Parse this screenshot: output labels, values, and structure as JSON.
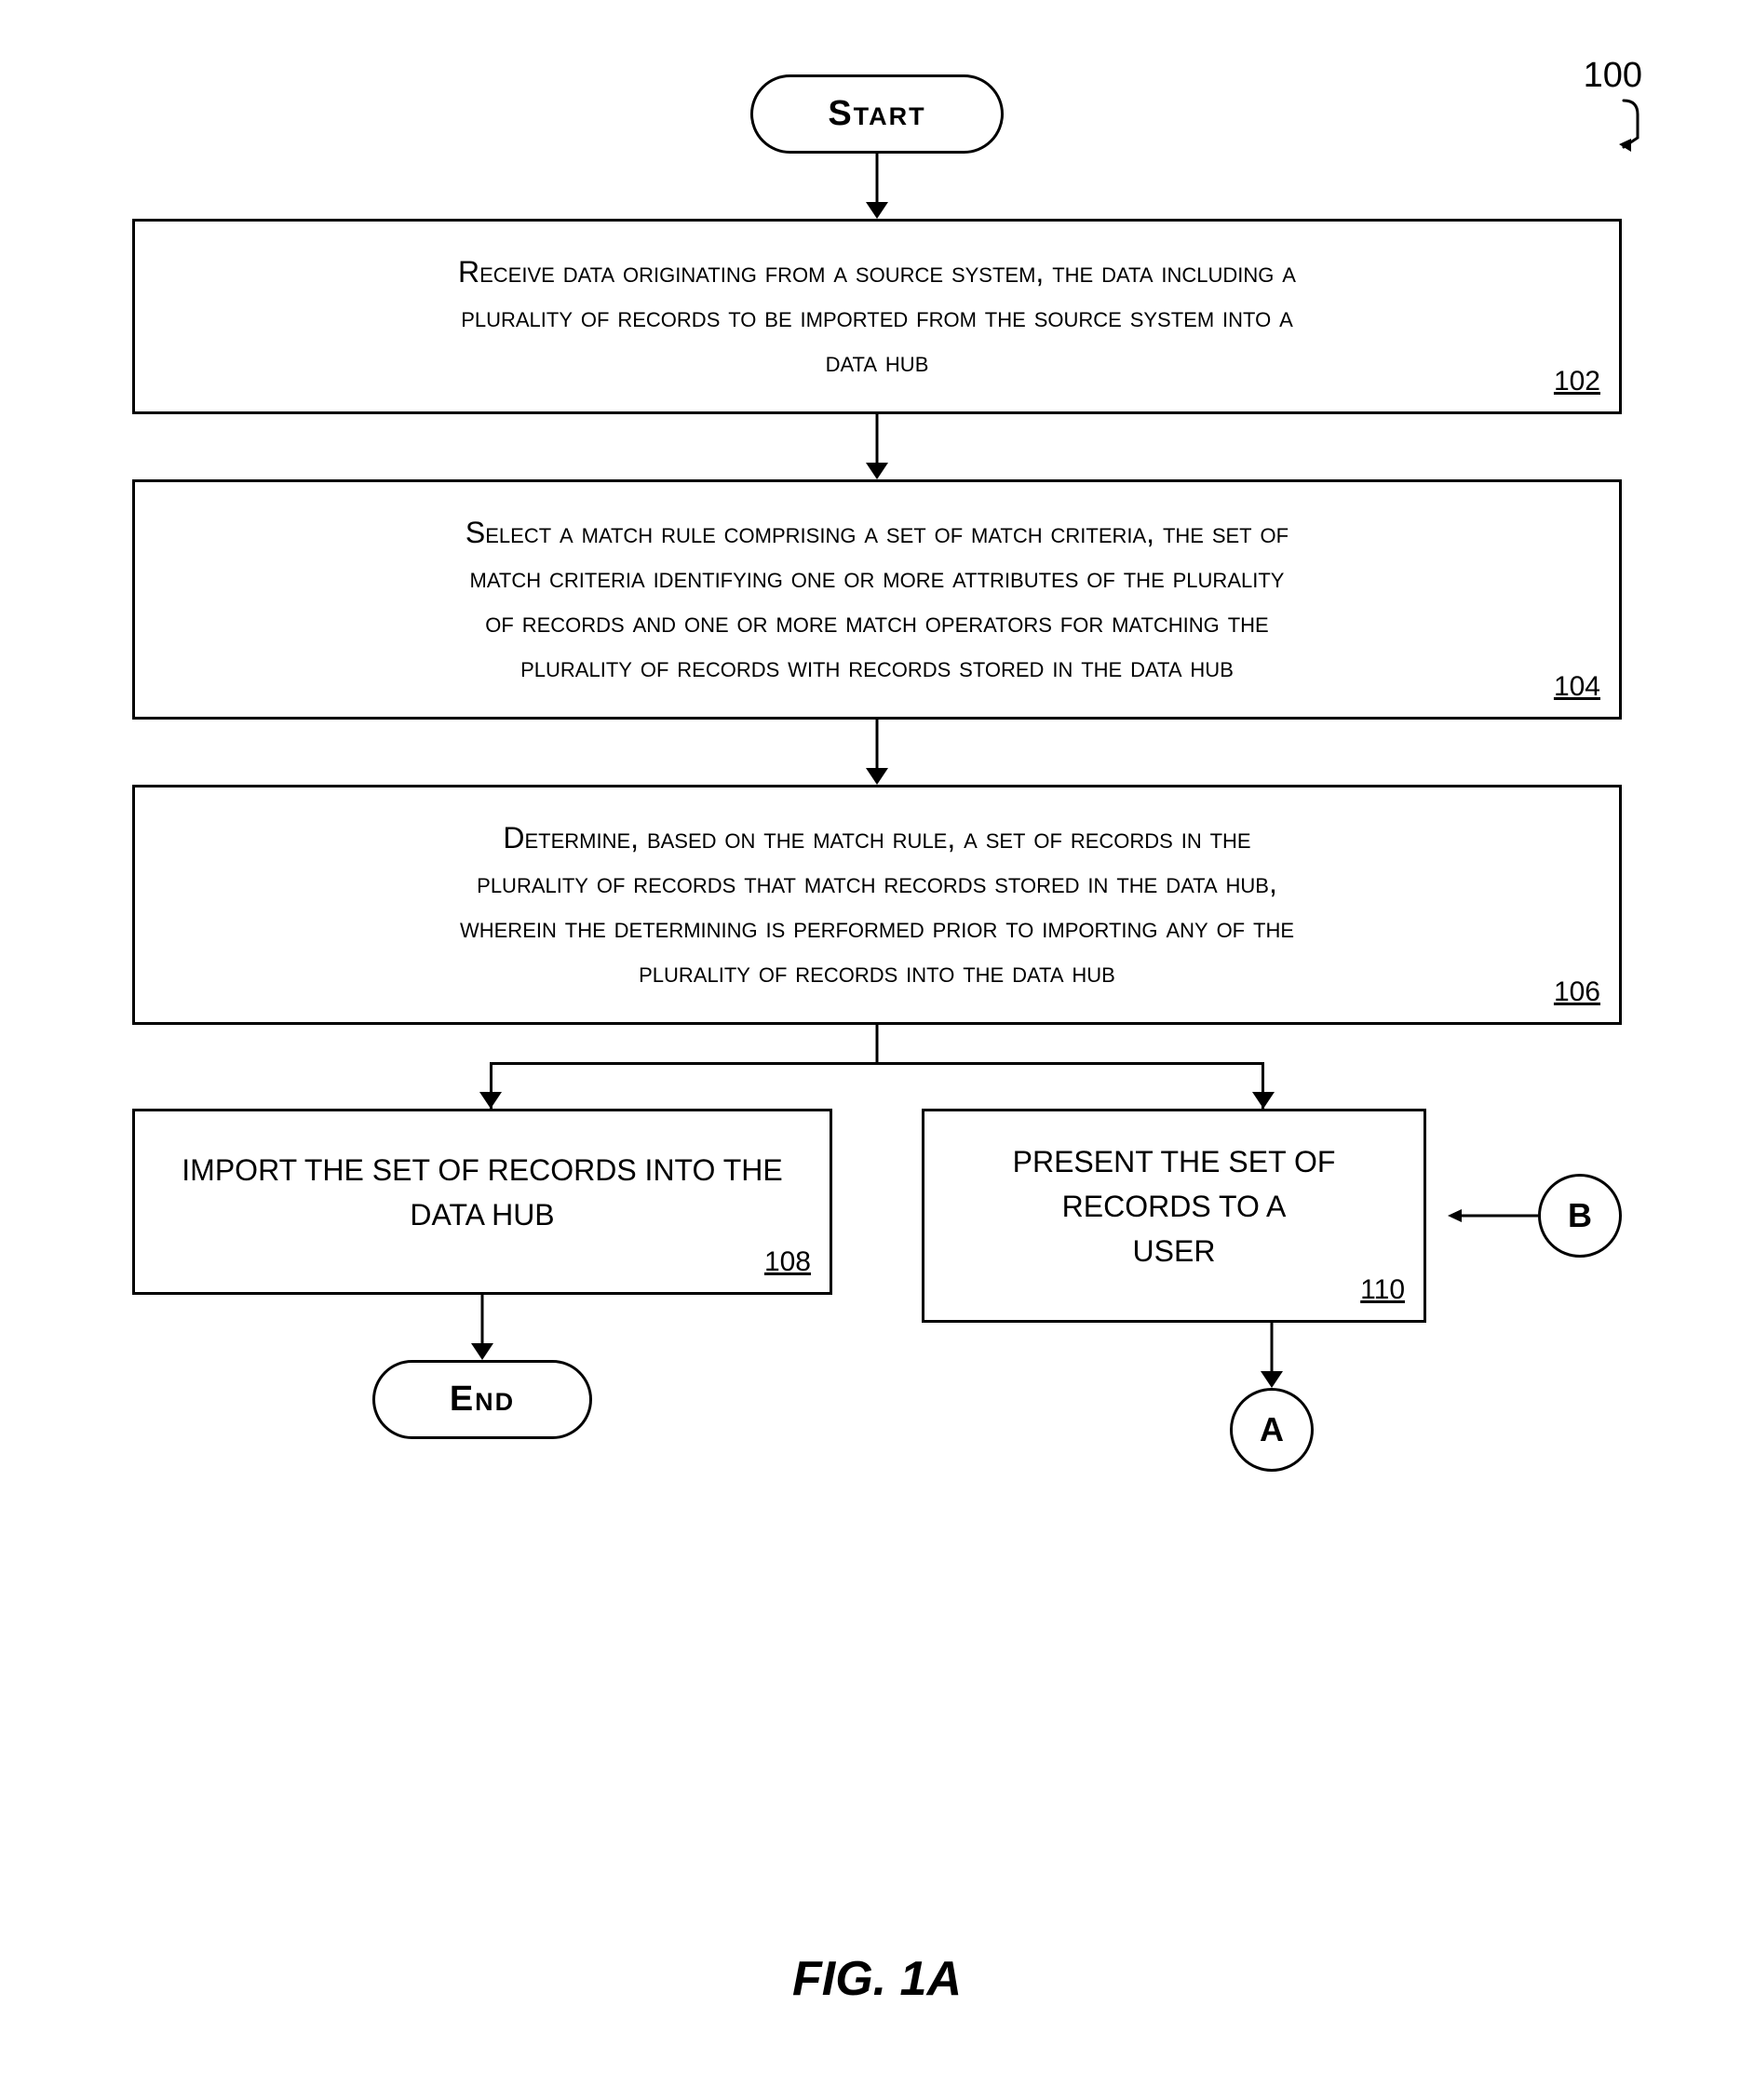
{
  "diagram": {
    "ref_number": "100",
    "figure_caption": "FIG. 1A",
    "start_label": "Start",
    "end_label": "End",
    "connector_a": "A",
    "connector_b": "B",
    "nodes": {
      "step102": {
        "text": "Receive data originating from a source system, the data including a plurality of records to be imported from the source system into a data hub",
        "ref": "102"
      },
      "step104": {
        "text": "Select a match rule comprising a set of match criteria, the set of match criteria identifying one or more attributes of the plurality of records and one or more match operators for matching the plurality of records with records stored in the data hub",
        "ref": "104"
      },
      "step106": {
        "text": "Determine, based on the match rule, a set of records in the plurality of records that match records stored in the data hub, wherein the determining is performed prior to importing any of the plurality of records into the data hub",
        "ref": "106"
      },
      "step108": {
        "text": "Import the set of records into the data hub",
        "ref": "108"
      },
      "step110": {
        "text": "Present the set of records to a user",
        "ref": "110"
      }
    }
  }
}
